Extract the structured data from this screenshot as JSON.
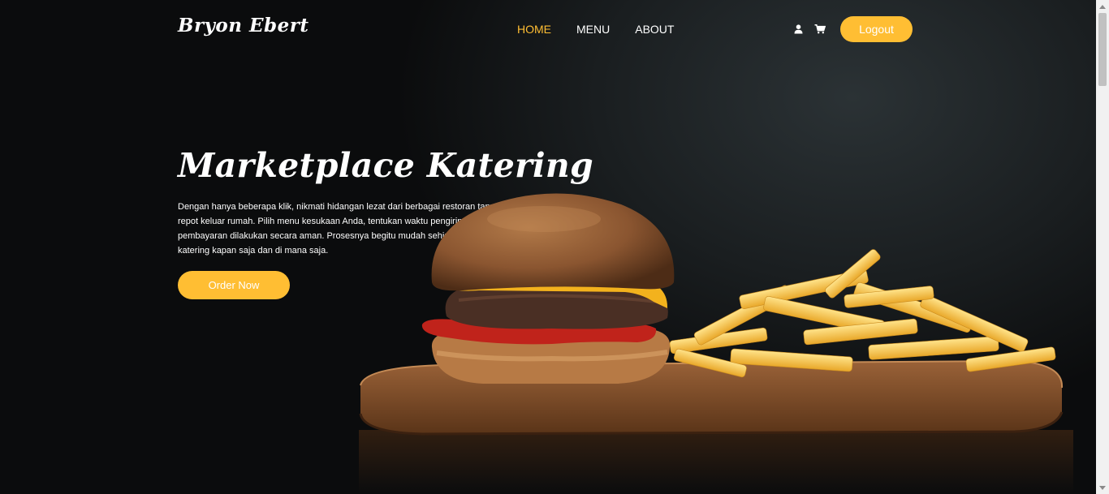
{
  "header": {
    "brand": "Bryon Ebert",
    "nav": [
      {
        "label": "HOME",
        "active": true
      },
      {
        "label": "MENU",
        "active": false
      },
      {
        "label": "ABOUT",
        "active": false
      }
    ],
    "icons": [
      "user-icon",
      "cart-icon"
    ],
    "logout_label": "Logout"
  },
  "hero": {
    "title": "Marketplace Katering",
    "description": "Dengan hanya beberapa klik, nikmati hidangan lezat dari berbagai restoran tanpa perlu repot keluar rumah. Pilih menu kesukaan Anda, tentukan waktu pengiriman, dan pembayaran dilakukan secara aman. Prosesnya begitu mudah sehingga Anda bisa pesan katering kapan saja dan di mana saja.",
    "cta_label": "Order Now",
    "image": "burger-and-fries-illustration"
  },
  "colors": {
    "accent": "#ffbe33",
    "background": "#0b0c0d",
    "text": "#ffffff"
  }
}
